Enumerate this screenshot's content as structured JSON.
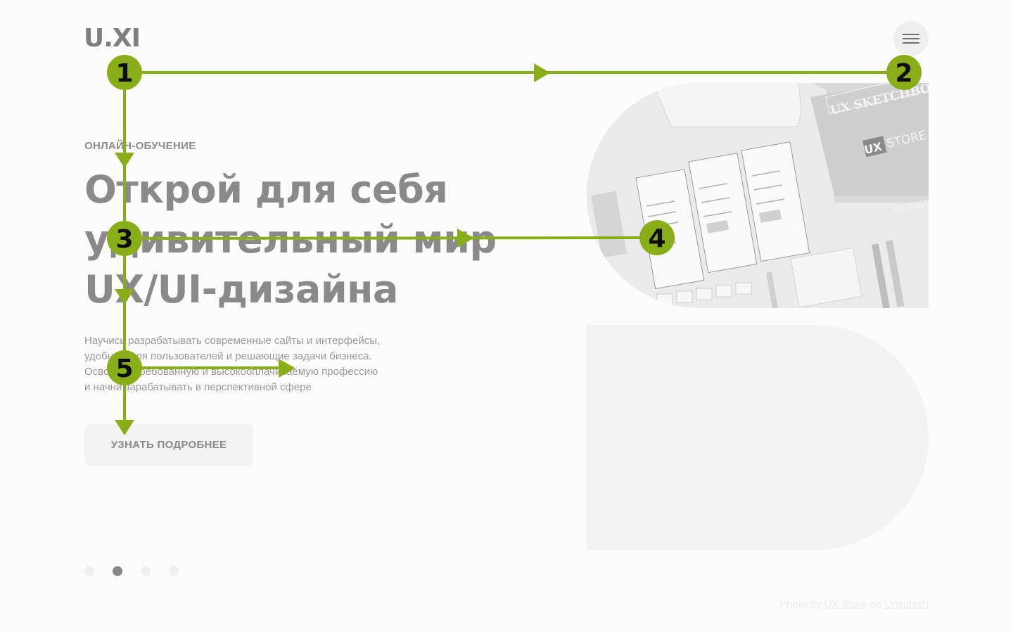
{
  "header": {
    "logo": "U.XI",
    "menu_icon": "hamburger-menu-icon"
  },
  "hero": {
    "eyebrow": "ОНЛАЙН-ОБУЧЕНИЕ",
    "title_lines": [
      "Открой для себя",
      "удивительный мир",
      "UX/UI-дизайна"
    ],
    "description_lines": [
      "Научись разрабатывать современные сайты и интерфейсы,",
      "удобные для пользователей и решающие задачи бизнеса.",
      "Освой востребованную и высокооплачиваемую профессию",
      "и начни зарабатывать в перспективной сфере"
    ],
    "cta_label": "УЗНАТЬ ПОДРОБНЕЕ"
  },
  "slider": {
    "dot_count": 4,
    "active_index": 1
  },
  "photo": {
    "labels": {
      "sketchbook": "UX SKETCHBOOK",
      "store_badge": "UX",
      "store_text": "STORE",
      "small_badge": "UX STORE"
    }
  },
  "credit": {
    "prefix": "Photo by",
    "author": "UX Store",
    "middle": "on",
    "site": "Unsplash"
  },
  "flow_overlay": {
    "color": "#8aae17",
    "markers": [
      "1",
      "2",
      "3",
      "4",
      "5"
    ]
  }
}
